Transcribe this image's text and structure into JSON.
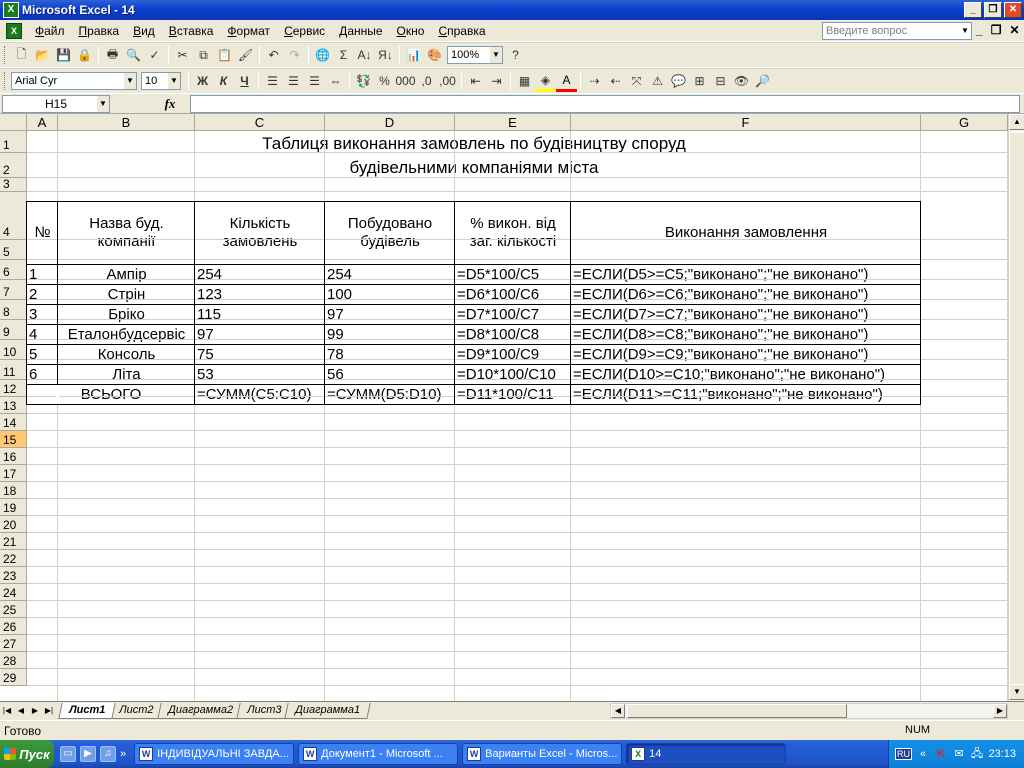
{
  "window": {
    "title": "Microsoft Excel - 14",
    "app_icon": "excel-icon"
  },
  "menu": [
    "Файл",
    "Правка",
    "Вид",
    "Вставка",
    "Формат",
    "Сервис",
    "Данные",
    "Окно",
    "Справка"
  ],
  "help_placeholder": "Введите вопрос",
  "toolbar": {
    "zoom": "100%",
    "font_name": "Arial Cyr",
    "font_size": "10",
    "bold": "Ж",
    "italic": "К",
    "underline": "Ч"
  },
  "formula_bar": {
    "name_box": "H15",
    "fx": "fx",
    "formula": ""
  },
  "columns": [
    "A",
    "B",
    "C",
    "D",
    "E",
    "F",
    "G"
  ],
  "rows": [
    "1",
    "2",
    "3",
    "4",
    "5",
    "6",
    "7",
    "8",
    "9",
    "10",
    "11",
    "12",
    "13",
    "14",
    "15",
    "16",
    "17",
    "18",
    "19",
    "20",
    "21",
    "22",
    "23",
    "24",
    "25",
    "26",
    "27",
    "28",
    "29"
  ],
  "active_row": "15",
  "sheet": {
    "title_line1": "Таблиця виконання замовлень по будівництву споруд",
    "title_line2": "будівельними компаніями міста",
    "headers": [
      "№",
      "Назва буд. компанії",
      "Кількість замовлень",
      "Побудовано будівель",
      "% викон. від заг. кількості",
      "Виконання замовлення"
    ],
    "data": [
      [
        "1",
        "Ампір",
        "254",
        "254",
        "=D5*100/C5",
        "=ЕСЛИ(D5>=C5;\"виконано\";\"не виконано\")"
      ],
      [
        "2",
        "Стрін",
        "123",
        "100",
        "=D6*100/C6",
        "=ЕСЛИ(D6>=C6;\"виконано\";\"не виконано\")"
      ],
      [
        "3",
        "Бріко",
        "115",
        "97",
        "=D7*100/C7",
        "=ЕСЛИ(D7>=C7;\"виконано\";\"не виконано\")"
      ],
      [
        "4",
        "Еталонбудсервіс",
        "97",
        "99",
        "=D8*100/C8",
        "=ЕСЛИ(D8>=C8;\"виконано\";\"не виконано\")"
      ],
      [
        "5",
        "Консоль",
        "75",
        "78",
        "=D9*100/C9",
        "=ЕСЛИ(D9>=C9;\"виконано\";\"не виконано\")"
      ],
      [
        "6",
        "Літа",
        "53",
        "56",
        "=D10*100/C10",
        "=ЕСЛИ(D10>=C10;\"виконано\";\"не виконано\")"
      ]
    ],
    "total": [
      "ВСЬОГО",
      "=СУММ(C5:C10)",
      "=СУММ(D5:D10)",
      "=D11*100/C11",
      "=ЕСЛИ(D11>=C11;\"виконано\";\"не виконано\")"
    ]
  },
  "tabs": [
    "Лист1",
    "Лист2",
    "Диаграмма2",
    "Лист3",
    "Диаграмма1"
  ],
  "active_tab": "Лист1",
  "status": {
    "ready": "Готово",
    "num": "NUM"
  },
  "taskbar": {
    "start": "Пуск",
    "tasks": [
      "ІНДИВІДУАЛЬНІ ЗАВДА...",
      "Документ1 - Microsoft ...",
      "Варианты Excel - Micros...",
      "14"
    ],
    "lang": "RU",
    "clock": "23:13"
  }
}
